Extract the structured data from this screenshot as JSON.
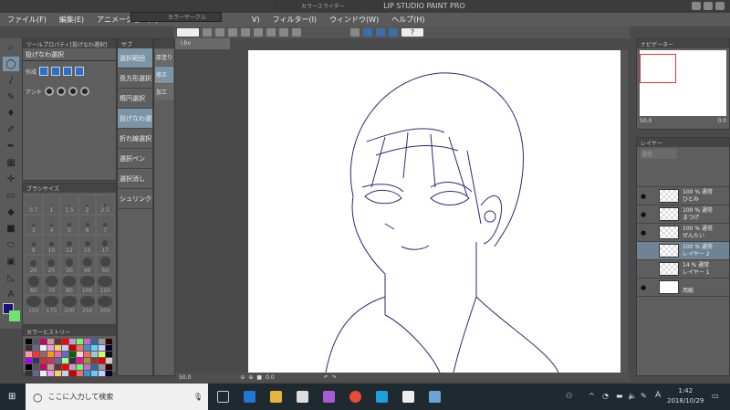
{
  "window": {
    "title": "(0.0%) - CLIP STUDIO PAINT PRO"
  },
  "menu": [
    "ファイル(F)",
    "編集(E)",
    "アニメーション(A)",
    "L",
    "V)",
    "フィルター(I)",
    "ウィンドウ(W)",
    "ヘルプ(H)"
  ],
  "floating": {
    "color_wheel": "カラーサークル",
    "color_slider": "カラースライダー"
  },
  "doc_tab": "I.bv",
  "tool_property": {
    "header": "ツールプロパティ[投げなわ選択]",
    "tool_name": "投げなわ選択",
    "create_label": "作成",
    "antialias_label": "アンチ"
  },
  "subtool": {
    "header": "サブ",
    "items": [
      {
        "label": "選択範囲",
        "selected": true
      },
      {
        "label": "長方形選択"
      },
      {
        "label": "楕円選択"
      },
      {
        "label": "投げなわ選択",
        "selected": true
      },
      {
        "label": "折れ線選択"
      },
      {
        "label": "選択ペン"
      },
      {
        "label": "選択消し"
      },
      {
        "label": "シュリンク選択"
      }
    ]
  },
  "subtool2": {
    "items": [
      {
        "label": "厚塗り"
      },
      {
        "label": "修正"
      },
      {
        "label": "加工"
      }
    ]
  },
  "brush_size": {
    "header": "ブラシサイズ",
    "sizes": [
      "0.7",
      "1",
      "1.5",
      "2",
      "2.5",
      "3",
      "4",
      "5",
      "6",
      "7",
      "8",
      "10",
      "12",
      "15",
      "17",
      "20",
      "25",
      "30",
      "40",
      "50",
      "60",
      "70",
      "80",
      "100",
      "120",
      "150",
      "170",
      "200",
      "250",
      "300"
    ]
  },
  "color_history": {
    "header": "カラーヒストリー"
  },
  "colors": {
    "main": "#1c1078",
    "sub": "#6fe36f",
    "accent": "#7b94a8",
    "line": "#2a2a7a"
  },
  "canvas_status": {
    "zoom": "50.0",
    "angle": "0.0"
  },
  "navigator": {
    "header": "ナビゲーター",
    "zoom": "50.0",
    "angle": "0.0"
  },
  "layers": {
    "header": "レイヤー",
    "blend": "通常",
    "items": [
      {
        "opacity": "100 %",
        "mode": "通常",
        "name": "ひとみ",
        "visible": true
      },
      {
        "opacity": "100 %",
        "mode": "通常",
        "name": "まつげ",
        "visible": true
      },
      {
        "opacity": "100 %",
        "mode": "通常",
        "name": "ぜんたい",
        "visible": true
      },
      {
        "opacity": "100 %",
        "mode": "通常",
        "name": "レイヤー 2",
        "visible": false,
        "selected": true
      },
      {
        "opacity": "14 %",
        "mode": "通常",
        "name": "レイヤー 1",
        "visible": false
      },
      {
        "opacity": "",
        "mode": "",
        "name": "用紙",
        "visible": true
      }
    ]
  },
  "taskbar": {
    "search_placeholder": "ここに入力して検索",
    "time": "1:42",
    "date": "2018/10/29",
    "ime": "A"
  }
}
